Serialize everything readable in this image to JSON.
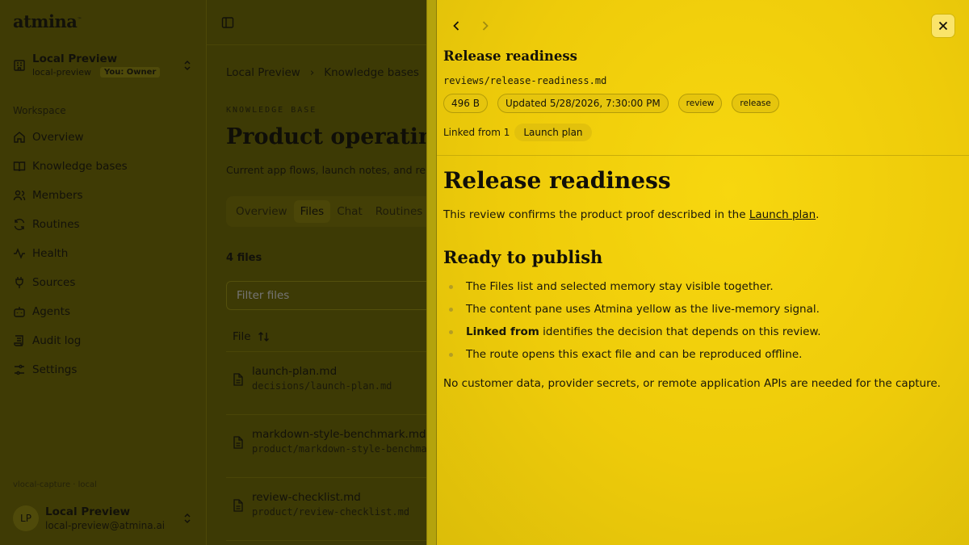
{
  "app": {
    "brand": "atmina",
    "brand_mark": "™"
  },
  "sidebar": {
    "workspace": {
      "name": "Local Preview",
      "slug": "local-preview",
      "role_badge": "You: Owner"
    },
    "section_label": "Workspace",
    "items": [
      {
        "label": "Overview",
        "icon": "home-icon"
      },
      {
        "label": "Knowledge bases",
        "icon": "book-icon"
      },
      {
        "label": "Members",
        "icon": "users-icon"
      },
      {
        "label": "Routines",
        "icon": "refresh-icon"
      },
      {
        "label": "Health",
        "icon": "activity-icon"
      },
      {
        "label": "Sources",
        "icon": "plug-icon"
      },
      {
        "label": "Agents",
        "icon": "bot-icon"
      },
      {
        "label": "Audit log",
        "icon": "scroll-icon"
      },
      {
        "label": "Settings",
        "icon": "sliders-icon"
      }
    ],
    "build_label": "vlocal-capture · local",
    "user": {
      "initials": "LP",
      "name": "Local Preview",
      "email": "local-preview@atmina.ai"
    }
  },
  "main": {
    "breadcrumb": [
      "Local Preview",
      "Knowledge bases"
    ],
    "eyebrow": "KNOWLEDGE BASE",
    "title": "Product operating",
    "subtitle": "Current app flows, launch notes, and re",
    "tabs": [
      {
        "label": "Overview",
        "active": false
      },
      {
        "label": "Files",
        "active": true
      },
      {
        "label": "Chat",
        "active": false
      },
      {
        "label": "Routines",
        "active": false
      }
    ],
    "files_count": "4 files",
    "filter_placeholder": "Filter files",
    "column_file": "File",
    "files": [
      {
        "name": "launch-plan.md",
        "path": "decisions/launch-plan.md"
      },
      {
        "name": "markdown-style-benchmark.md",
        "path": "product/markdown-style-benchma"
      },
      {
        "name": "review-checklist.md",
        "path": "product/review-checklist.md"
      }
    ]
  },
  "drawer": {
    "title": "Release readiness",
    "path": "reviews/release-readiness.md",
    "size": "496 B",
    "updated": "Updated 5/28/2026, 7:30:00 PM",
    "tags": [
      "review",
      "release"
    ],
    "linked_label": "Linked from 1",
    "linked_item": "Launch plan",
    "accent_color": "#f5d40e",
    "content": {
      "h1": "Release readiness",
      "intro_before": "This review confirms the product proof described in the ",
      "intro_link": "Launch plan",
      "intro_after": ".",
      "h2": "Ready to publish",
      "bullets": [
        {
          "bold": "",
          "text": "The Files list and selected memory stay visible together."
        },
        {
          "bold": "",
          "text": "The content pane uses Atmina yellow as the live-memory signal."
        },
        {
          "bold": "Linked from",
          "text": " identifies the decision that depends on this review."
        },
        {
          "bold": "",
          "text": "The route opens this exact file and can be reproduced offline."
        }
      ],
      "closing": "No customer data, provider secrets, or remote application APIs are needed for the capture."
    }
  }
}
